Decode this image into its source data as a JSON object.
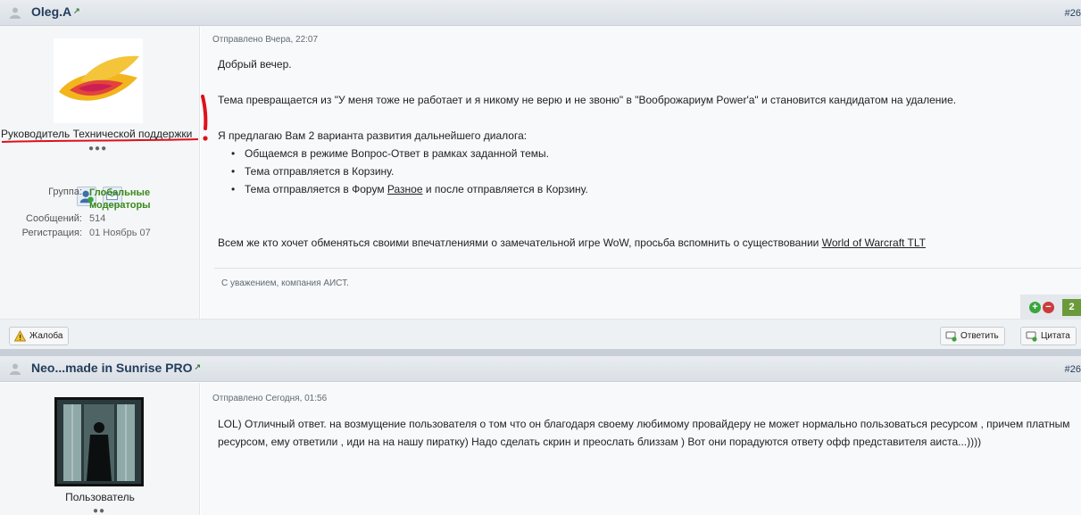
{
  "post1": {
    "author": "Oleg.A",
    "external_glyph": "↗",
    "post_number": "#26",
    "posted_label": "Отправлено Вчера, 22:07",
    "rank": "Руководитель Технической поддержки",
    "dots": "●●●",
    "profile_icon": "user-profile-icon",
    "message_icon": "envelope-icon",
    "group_label": "Группа:",
    "group_value_line1": "Глобальные",
    "group_value_line2": "модераторы",
    "posts_label": "Сообщений:",
    "posts_value": "514",
    "reg_label": "Регистрация:",
    "reg_value": "01 Ноябрь 07",
    "body": {
      "greeting": "Добрый вечер.",
      "p1": "Тема превращается из \"У меня тоже не работает и я никому не верю и не звоню\" в \"Вооброжариум Power'a\" и становится кандидатом на удаление.",
      "p2": "Я предлагаю Вам 2 варианта развития дальнейшего диалога:",
      "li1": "Общаемся в режиме Вопрос-Ответ в рамках заданной темы.",
      "li2": "Тема отправляется в Корзину.",
      "li3_before": "Тема отправляется в Форум ",
      "li3_link": "Разное",
      "li3_after": " и после отправляется в Корзину.",
      "p3_before": "Всем же кто хочет обменяться своими впечатлениями о замечательной игре WoW, просьба вспомнить о существовании ",
      "p3_link": "World of Warcraft TLT"
    },
    "signature": "С уважением, компания АИСТ.",
    "rep_plus": "+",
    "rep_minus": "−",
    "rep_count": "2",
    "complaint_label": "Жалоба",
    "reply_label": "Ответить",
    "quote_label": "Цитата"
  },
  "post2": {
    "author": "Neo...made in Sunrise PRO",
    "external_glyph": "↗",
    "post_number": "#26",
    "posted_label": "Отправлено Сегодня, 01:56",
    "rank": "Пользователь",
    "dots": "●●",
    "body": "LOL) Отличный ответ. на возмущение пользователя о том что он благодаря своему любимому провайдеру не может нормально пользоваться ресурсом , причем платным ресурсом, ему ответили , иди на на нашу пиратку) Надо сделать скрин и преослать близзам ) Вот они порадуются ответу офф представителя аиста...))))"
  },
  "colors": {
    "author": "#243d5b",
    "group_green": "#3a8a1a",
    "rep_green": "#6b9a3a",
    "red_marker": "#e0101a"
  }
}
